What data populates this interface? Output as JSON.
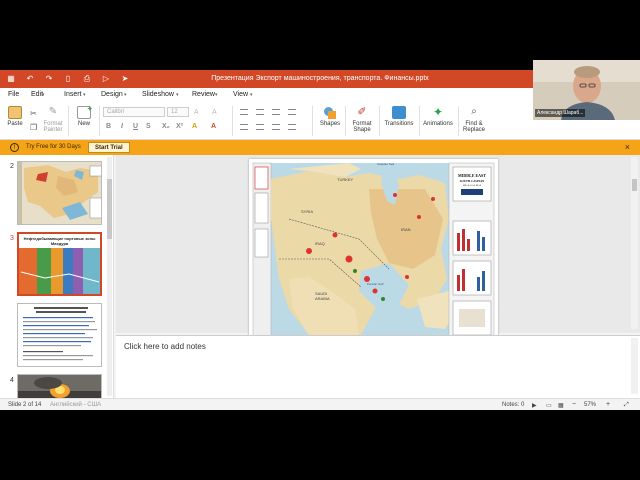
{
  "window": {
    "title": "Презентация Экспорт машиностроения, транспорта. Финансы.pptx"
  },
  "menu": [
    "File",
    "Edit",
    "Insert",
    "Design",
    "Slideshow",
    "Review",
    "View"
  ],
  "ribbon": {
    "paste": "Paste",
    "format_painter_1": "Format",
    "format_painter_2": "Painter",
    "new_1": "New",
    "font_name": "Calibri",
    "font_size": "12",
    "shapes": "Shapes",
    "format_shape_1": "Format",
    "format_shape_2": "Shape",
    "transitions": "Transitions",
    "animations": "Animations",
    "find_replace_1": "Find &",
    "find_replace_2": "Replace"
  },
  "trial": {
    "text": "Try Free for 30 Days",
    "button": "Start Trial",
    "close": "×"
  },
  "slides_panel": {
    "numbers": [
      "2",
      "3",
      "4",
      "5"
    ],
    "thumb3_title": "Нефтедобывающие портовые зоны Махдура"
  },
  "editor": {
    "map_title_1": "MIDDLE EAST",
    "map_title_2": "SOUTH CASPIAN",
    "map_title_3": "OIL & GAS MAP",
    "labels": [
      "TURKEY",
      "SYRIA",
      "IRAQ",
      "IRAN",
      "SAUDI",
      "ARABIA",
      "Caspian Sea",
      "Persian Gulf"
    ]
  },
  "notes": {
    "placeholder": "Click here to add notes"
  },
  "status": {
    "slide": "Slide 2 of 14",
    "lang": "Английский - США",
    "notes": "Notes: 0",
    "zoom": "57%"
  },
  "webcam": {
    "name": "Александр Шараб..."
  },
  "colors": {
    "accent": "#d24726",
    "trial_bar": "#f6a417"
  }
}
